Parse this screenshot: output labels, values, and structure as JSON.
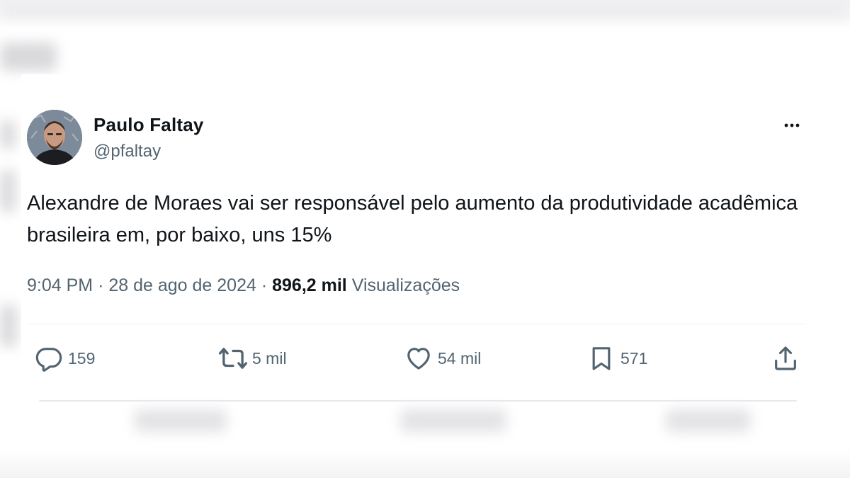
{
  "author": {
    "name": "Paulo Faltay",
    "handle": "@pfaltay"
  },
  "tweet": {
    "text": "Alexandre de Moraes vai ser responsável pelo aumento da produtividade acadêmica brasileira em, por baixo, uns 15%",
    "time": "9:04 PM",
    "separator": "·",
    "date": "28 de ago de 2024",
    "views_count": "896,2 mil",
    "views_label": "Visualizações"
  },
  "actions": {
    "replies": "159",
    "retweets": "5 mil",
    "likes": "54 mil",
    "bookmarks": "571"
  },
  "icons": {
    "more": "more-horizontal-icon",
    "reply": "comment-bubble-icon",
    "retweet": "retweet-arrows-icon",
    "like": "heart-icon",
    "bookmark": "bookmark-icon",
    "share": "share-upload-icon"
  },
  "colors": {
    "text": "#0f1419",
    "secondary": "#536471",
    "divider": "#eff3f4"
  }
}
